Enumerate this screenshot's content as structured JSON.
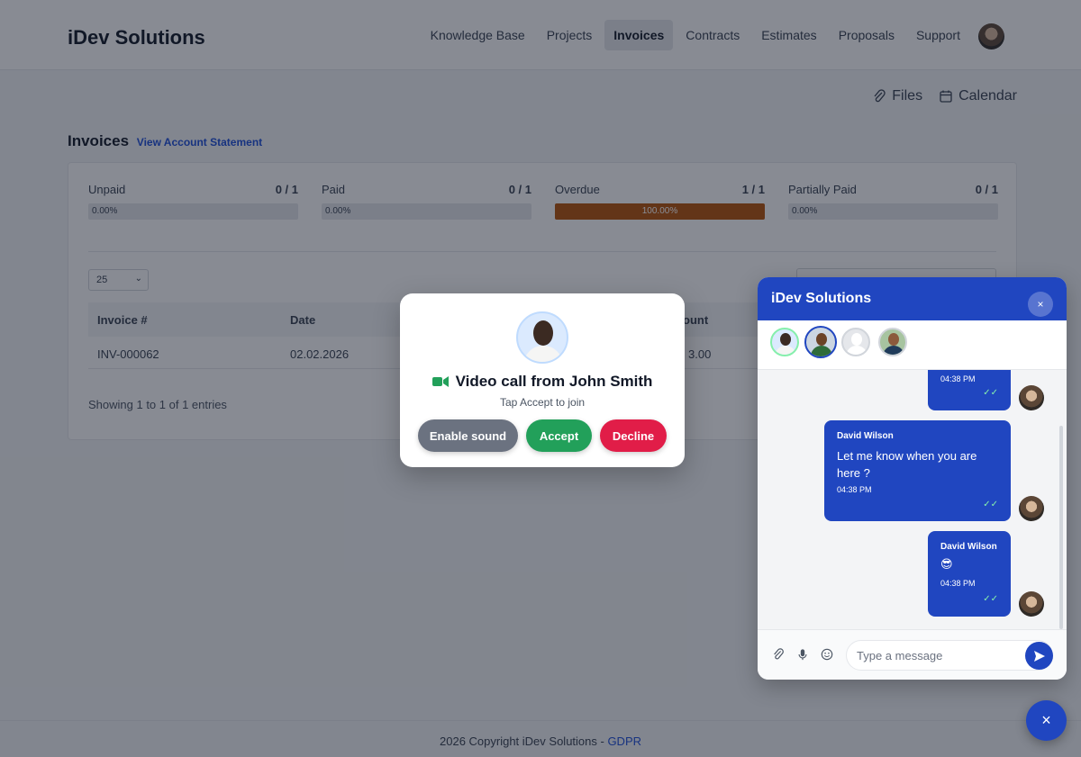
{
  "brand": "iDev Solutions",
  "nav": {
    "items": [
      "Knowledge Base",
      "Projects",
      "Invoices",
      "Contracts",
      "Estimates",
      "Proposals",
      "Support"
    ],
    "active": "Invoices"
  },
  "quicklinks": {
    "files": "Files",
    "calendar": "Calendar"
  },
  "invoices": {
    "title": "Invoices",
    "statement_link": "View Account Statement",
    "stats": [
      {
        "label": "Unpaid",
        "count": "0 / 1",
        "percent_label": "0.00%",
        "percent": 0
      },
      {
        "label": "Paid",
        "count": "0 / 1",
        "percent_label": "0.00%",
        "percent": 0
      },
      {
        "label": "Overdue",
        "count": "1 / 1",
        "percent_label": "100.00%",
        "percent": 100
      },
      {
        "label": "Partially Paid",
        "count": "0 / 1",
        "percent_label": "0.00%",
        "percent": 0
      }
    ],
    "page_size": "25",
    "columns": [
      "Invoice #",
      "Date",
      "ount"
    ],
    "row": {
      "invoice": "INV-000062",
      "date": "02.02.2026",
      "amount": "3.00"
    },
    "showing": "Showing 1 to 1 of 1 entries"
  },
  "footer": {
    "text": "2026 Copyright iDev Solutions - ",
    "link": "GDPR"
  },
  "call": {
    "title": "Video call from John Smith",
    "subtitle": "Tap Accept to join",
    "enable_sound": "Enable sound",
    "accept": "Accept",
    "decline": "Decline"
  },
  "chat": {
    "title": "iDev Solutions",
    "close": "×",
    "messages": [
      {
        "time": "04:38 PM"
      },
      {
        "sender": "David Wilson",
        "text_line1": "Let me know when you are",
        "text_line2": "here ?",
        "time": "04:38 PM"
      },
      {
        "sender": "David Wilson",
        "text": "😎",
        "time": "04:38 PM"
      }
    ],
    "placeholder": "Type a message"
  },
  "fab": "×",
  "colors": {
    "primary": "#2046c0",
    "accept": "#22a05a",
    "decline": "#e11d48",
    "overdue": "#b45309"
  }
}
